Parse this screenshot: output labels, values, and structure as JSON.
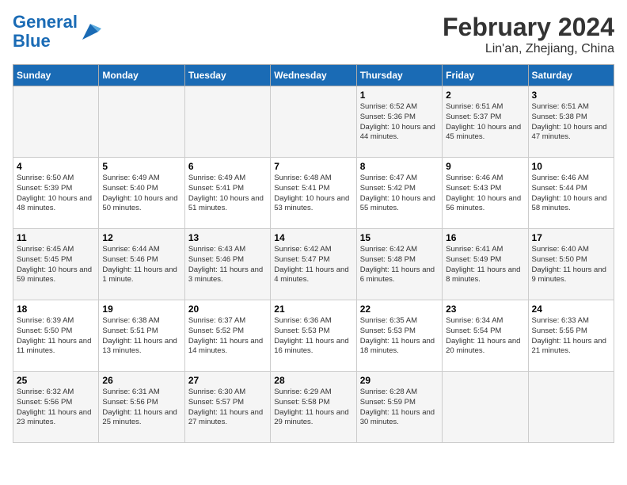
{
  "logo": {
    "text_general": "General",
    "text_blue": "Blue"
  },
  "title": "February 2024",
  "subtitle": "Lin'an, Zhejiang, China",
  "weekdays": [
    "Sunday",
    "Monday",
    "Tuesday",
    "Wednesday",
    "Thursday",
    "Friday",
    "Saturday"
  ],
  "weeks": [
    [
      {
        "day": "",
        "info": ""
      },
      {
        "day": "",
        "info": ""
      },
      {
        "day": "",
        "info": ""
      },
      {
        "day": "",
        "info": ""
      },
      {
        "day": "1",
        "info": "Sunrise: 6:52 AM\nSunset: 5:36 PM\nDaylight: 10 hours and 44 minutes."
      },
      {
        "day": "2",
        "info": "Sunrise: 6:51 AM\nSunset: 5:37 PM\nDaylight: 10 hours and 45 minutes."
      },
      {
        "day": "3",
        "info": "Sunrise: 6:51 AM\nSunset: 5:38 PM\nDaylight: 10 hours and 47 minutes."
      }
    ],
    [
      {
        "day": "4",
        "info": "Sunrise: 6:50 AM\nSunset: 5:39 PM\nDaylight: 10 hours and 48 minutes."
      },
      {
        "day": "5",
        "info": "Sunrise: 6:49 AM\nSunset: 5:40 PM\nDaylight: 10 hours and 50 minutes."
      },
      {
        "day": "6",
        "info": "Sunrise: 6:49 AM\nSunset: 5:41 PM\nDaylight: 10 hours and 51 minutes."
      },
      {
        "day": "7",
        "info": "Sunrise: 6:48 AM\nSunset: 5:41 PM\nDaylight: 10 hours and 53 minutes."
      },
      {
        "day": "8",
        "info": "Sunrise: 6:47 AM\nSunset: 5:42 PM\nDaylight: 10 hours and 55 minutes."
      },
      {
        "day": "9",
        "info": "Sunrise: 6:46 AM\nSunset: 5:43 PM\nDaylight: 10 hours and 56 minutes."
      },
      {
        "day": "10",
        "info": "Sunrise: 6:46 AM\nSunset: 5:44 PM\nDaylight: 10 hours and 58 minutes."
      }
    ],
    [
      {
        "day": "11",
        "info": "Sunrise: 6:45 AM\nSunset: 5:45 PM\nDaylight: 10 hours and 59 minutes."
      },
      {
        "day": "12",
        "info": "Sunrise: 6:44 AM\nSunset: 5:46 PM\nDaylight: 11 hours and 1 minute."
      },
      {
        "day": "13",
        "info": "Sunrise: 6:43 AM\nSunset: 5:46 PM\nDaylight: 11 hours and 3 minutes."
      },
      {
        "day": "14",
        "info": "Sunrise: 6:42 AM\nSunset: 5:47 PM\nDaylight: 11 hours and 4 minutes."
      },
      {
        "day": "15",
        "info": "Sunrise: 6:42 AM\nSunset: 5:48 PM\nDaylight: 11 hours and 6 minutes."
      },
      {
        "day": "16",
        "info": "Sunrise: 6:41 AM\nSunset: 5:49 PM\nDaylight: 11 hours and 8 minutes."
      },
      {
        "day": "17",
        "info": "Sunrise: 6:40 AM\nSunset: 5:50 PM\nDaylight: 11 hours and 9 minutes."
      }
    ],
    [
      {
        "day": "18",
        "info": "Sunrise: 6:39 AM\nSunset: 5:50 PM\nDaylight: 11 hours and 11 minutes."
      },
      {
        "day": "19",
        "info": "Sunrise: 6:38 AM\nSunset: 5:51 PM\nDaylight: 11 hours and 13 minutes."
      },
      {
        "day": "20",
        "info": "Sunrise: 6:37 AM\nSunset: 5:52 PM\nDaylight: 11 hours and 14 minutes."
      },
      {
        "day": "21",
        "info": "Sunrise: 6:36 AM\nSunset: 5:53 PM\nDaylight: 11 hours and 16 minutes."
      },
      {
        "day": "22",
        "info": "Sunrise: 6:35 AM\nSunset: 5:53 PM\nDaylight: 11 hours and 18 minutes."
      },
      {
        "day": "23",
        "info": "Sunrise: 6:34 AM\nSunset: 5:54 PM\nDaylight: 11 hours and 20 minutes."
      },
      {
        "day": "24",
        "info": "Sunrise: 6:33 AM\nSunset: 5:55 PM\nDaylight: 11 hours and 21 minutes."
      }
    ],
    [
      {
        "day": "25",
        "info": "Sunrise: 6:32 AM\nSunset: 5:56 PM\nDaylight: 11 hours and 23 minutes."
      },
      {
        "day": "26",
        "info": "Sunrise: 6:31 AM\nSunset: 5:56 PM\nDaylight: 11 hours and 25 minutes."
      },
      {
        "day": "27",
        "info": "Sunrise: 6:30 AM\nSunset: 5:57 PM\nDaylight: 11 hours and 27 minutes."
      },
      {
        "day": "28",
        "info": "Sunrise: 6:29 AM\nSunset: 5:58 PM\nDaylight: 11 hours and 29 minutes."
      },
      {
        "day": "29",
        "info": "Sunrise: 6:28 AM\nSunset: 5:59 PM\nDaylight: 11 hours and 30 minutes."
      },
      {
        "day": "",
        "info": ""
      },
      {
        "day": "",
        "info": ""
      }
    ]
  ]
}
